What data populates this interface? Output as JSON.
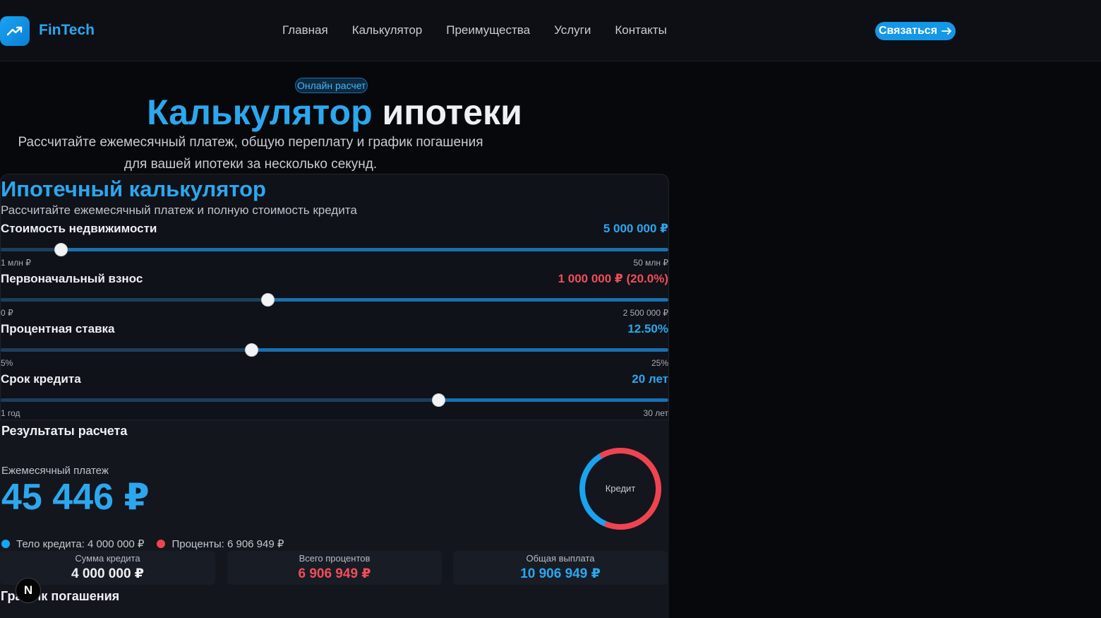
{
  "header": {
    "brand": "FinTech",
    "nav": [
      "Главная",
      "Калькулятор",
      "Преимущества",
      "Услуги",
      "Контакты"
    ],
    "cta_label": "Связаться",
    "cta_icon": "arrow-right-icon",
    "accent": "#1597e8"
  },
  "hero": {
    "badge": "Онлайн расчет",
    "title_blue": "Калькулятор",
    "title_white": " ипотеки",
    "subtitle_line1": "Рассчитайте ежемесячный платеж, общую переплату и график погашения",
    "subtitle_line2": "для вашей ипотеки за несколько секунд."
  },
  "calculator": {
    "title": "Ипотечный калькулятор",
    "subtitle": "Рассчитайте ежемесячный платеж и полную стоимость кредита",
    "sliders": [
      {
        "label": "Стоимость недвижимости",
        "value": "5 000 000 ₽",
        "value_color": "#2ca7ee",
        "min": "1 млн ₽",
        "max": "50 млн ₽",
        "fraction": 0.09
      },
      {
        "label": "Первоначальный взнос",
        "value": "1 000 000 ₽ (20.0%)",
        "value_color": "#ef4e5a",
        "min": "0 ₽",
        "max": "2 500 000 ₽",
        "fraction": 0.4
      },
      {
        "label": "Процентная ставка",
        "value": "12.50%",
        "value_color": "#2ca7ee",
        "min": "5%",
        "max": "25%",
        "fraction": 0.375
      },
      {
        "label": "Срок кредита",
        "value": "20 лет",
        "value_color": "#2ca7ee",
        "min": "1 год",
        "max": "30 лет",
        "fraction": 0.655
      }
    ]
  },
  "results": {
    "title": "Результаты расчета",
    "monthly_label": "Ежемесячный платеж",
    "monthly_value": "45 446 ₽",
    "legend": [
      {
        "label": "Тело кредита: 4 000 000 ₽",
        "color": "#1aa3f0"
      },
      {
        "label": "Проценты: 6 906 949 ₽",
        "color": "#ef4450"
      }
    ],
    "donut_label": "Кредит",
    "donut_segments": [
      {
        "name": "principal",
        "fraction": 0.367,
        "color": "#1aa3f0"
      },
      {
        "name": "interest",
        "fraction": 0.633,
        "color": "#ef4450"
      }
    ],
    "stats": [
      {
        "label": "Сумма кредита",
        "value": "4 000 000 ₽",
        "color": "#eef0f4"
      },
      {
        "label": "Всего процентов",
        "value": "6 906 949 ₽",
        "color": "#ef4e5a"
      },
      {
        "label": "Общая выплата",
        "value": "10 906 949 ₽",
        "color": "#2ca7ee"
      }
    ],
    "schedule_title": "График погашения"
  },
  "overlay": {
    "n_badge": "N"
  }
}
